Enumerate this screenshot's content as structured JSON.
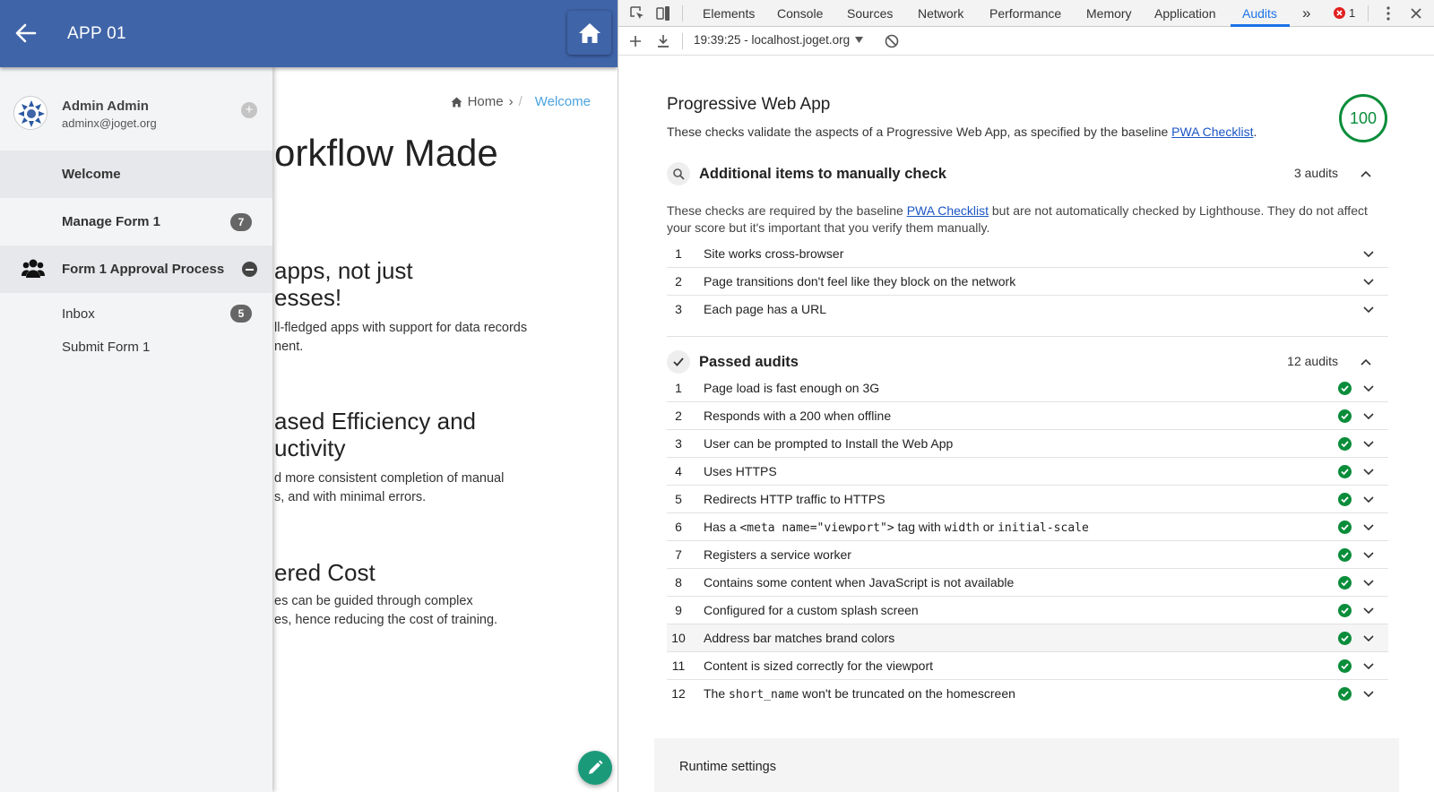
{
  "app": {
    "title": "APP 01",
    "breadcrumb": {
      "home": "Home",
      "separator": "›",
      "slash": "/",
      "current": "Welcome"
    },
    "hero_title": "orkflow Made",
    "features": [
      {
        "title_l1": "apps, not just",
        "title_l2": "esses!",
        "text_l1": "ll-fledged apps with support for data records",
        "text_l2": "nent."
      },
      {
        "title_l1": "ased Efficiency and",
        "title_l2": "uctivity",
        "text_l1": "d more consistent completion of manual",
        "text_l2": "s, and with minimal errors."
      },
      {
        "title_l1": "ered Cost",
        "title_l2": "",
        "text_l1": "es can be guided through complex",
        "text_l2": "es, hence reducing the cost of training."
      }
    ],
    "colors": {
      "header": "#3f64a8",
      "fab": "#1b9a7a",
      "breadcrumb_active": "#4aa3df"
    }
  },
  "drawer": {
    "profile": {
      "name": "Admin Admin",
      "email": "adminx@joget.org",
      "add_icon": "+"
    },
    "items": [
      {
        "label": "Welcome"
      },
      {
        "label": "Manage Form 1",
        "badge": "7"
      },
      {
        "label": "Form 1 Approval Process"
      },
      {
        "label": "Inbox",
        "badge": "5"
      },
      {
        "label": "Submit Form 1"
      }
    ]
  },
  "devtools": {
    "tabs": [
      "Elements",
      "Console",
      "Sources",
      "Network",
      "Performance",
      "Memory",
      "Application",
      "Audits"
    ],
    "active_tab": "Audits",
    "more_tabs": "»",
    "error_count": "1",
    "toolbar": {
      "report_selector": "19:39:25 - localhost.joget.org"
    },
    "report": {
      "category_title": "Progressive Web App",
      "category_desc_prefix": "These checks validate the aspects of a Progressive Web App, as specified by the baseline ",
      "category_desc_link": "PWA Checklist",
      "category_desc_suffix": ".",
      "score": "100",
      "manual": {
        "title": "Additional items to manually check",
        "count": "3 audits",
        "desc_prefix": "These checks are required by the baseline ",
        "desc_link": "PWA Checklist",
        "desc_suffix": " but are not automatically checked by Lighthouse. They do not affect your score but it's important that you verify them manually.",
        "items": [
          {
            "num": "1",
            "title": "Site works cross-browser"
          },
          {
            "num": "2",
            "title": "Page transitions don't feel like they block on the network"
          },
          {
            "num": "3",
            "title": "Each page has a URL"
          }
        ]
      },
      "passed": {
        "title": "Passed audits",
        "count": "12 audits",
        "items": [
          {
            "num": "1",
            "title": "Page load is fast enough on 3G"
          },
          {
            "num": "2",
            "title": "Responds with a 200 when offline"
          },
          {
            "num": "3",
            "title": "User can be prompted to Install the Web App"
          },
          {
            "num": "4",
            "title": "Uses HTTPS"
          },
          {
            "num": "5",
            "title": "Redirects HTTP traffic to HTTPS"
          },
          {
            "num": "6",
            "title_a": "Has a ",
            "code_a": "<meta name=\"viewport\">",
            "title_b": " tag with ",
            "code_b": "width",
            "title_c": " or ",
            "code_c": "initial-scale"
          },
          {
            "num": "7",
            "title": "Registers a service worker"
          },
          {
            "num": "8",
            "title": "Contains some content when JavaScript is not available"
          },
          {
            "num": "9",
            "title": "Configured for a custom splash screen"
          },
          {
            "num": "10",
            "title": "Address bar matches brand colors"
          },
          {
            "num": "11",
            "title": "Content is sized correctly for the viewport"
          },
          {
            "num": "12",
            "title_a": "The ",
            "code_a": "short_name",
            "title_b": " won't be truncated on the homescreen"
          }
        ]
      },
      "runtime_title": "Runtime settings",
      "colors": {
        "pass": "#0a8d3a",
        "link": "#1a55c4",
        "active_tab": "#1a73e8"
      }
    }
  }
}
